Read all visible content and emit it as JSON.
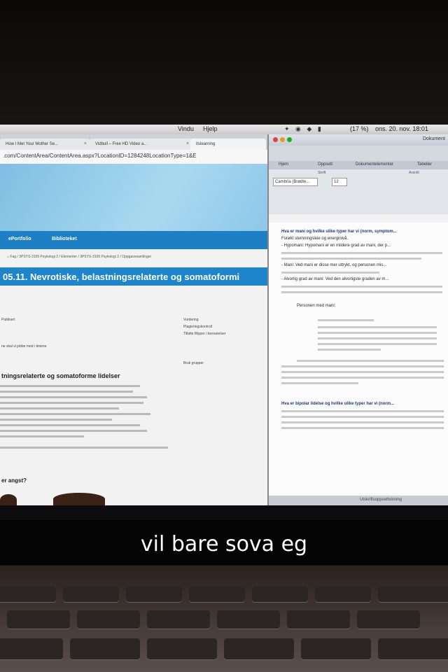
{
  "menubar": {
    "menus": [
      "Vindu",
      "Hjelp"
    ],
    "status_text": "(17 %)",
    "date_time": "ons. 20. nov. 18:01"
  },
  "browser": {
    "tabs": [
      {
        "label": "How I Met Your Mother Se..."
      },
      {
        "label": "Vidbull – Free HD Video a..."
      },
      {
        "label": "itslearning"
      }
    ],
    "url": ".com/ContentArea/ContentArea.aspx?LocationID=1284248LocationType=1&E",
    "nav": [
      "ePortfolio",
      "Biblioteket"
    ],
    "breadcrumb": "Fag / 3PSYS-3105 Psykologi 2 / Elementer / 3PSYS-3105 Psykologi 2 / Oppgavesamlinger",
    "page_title": "05.11. Nevrotiske, belastningsrelaterte og somatoformi",
    "meta_left": [
      "Publisert",
      "ne skal vi jobbe med i timene"
    ],
    "meta_right_labels": [
      "Vurdering",
      "Plagieringskontroll",
      "Tillatte filtyper i besvarelser"
    ],
    "meta_right_extra": "Bruk grupper",
    "section_title": "tningsrelaterte og somatoforme lidelser",
    "question": "er angst?"
  },
  "word": {
    "title": "Dokument",
    "ribbon_tabs": [
      "Hjem",
      "Oppsett",
      "Dokumentelementer",
      "Tabeller"
    ],
    "ribbon_groups": [
      "Skrift",
      "Avsnitt"
    ],
    "font_name": "Cambria (Brødte...",
    "font_size": "12",
    "doc_paragraphs": [
      {
        "text": "Hva er mani og hvilke ulike typer har vi (norm, symptom...",
        "bold": true
      },
      {
        "text": "Forøkt stemningsleie og energinivå."
      },
      {
        "text": "- Hypomani: Hypomani er en mildere grad av mani, der p..."
      },
      {
        "text": "- Mani: Ved mani er disse mer uttrykt, og personen mis..."
      },
      {
        "text": "- Alvorlig grad av mani: Ved den alvorligste graden av m..."
      },
      {
        "text": "Personen med mani:"
      },
      {
        "text": "Hva er bipolar lidelse og hvilke ulike typer har vi (norm...",
        "bold": true
      }
    ],
    "status": "Utskriftsoppsettvisning"
  },
  "caption": "vil bare sova eg"
}
